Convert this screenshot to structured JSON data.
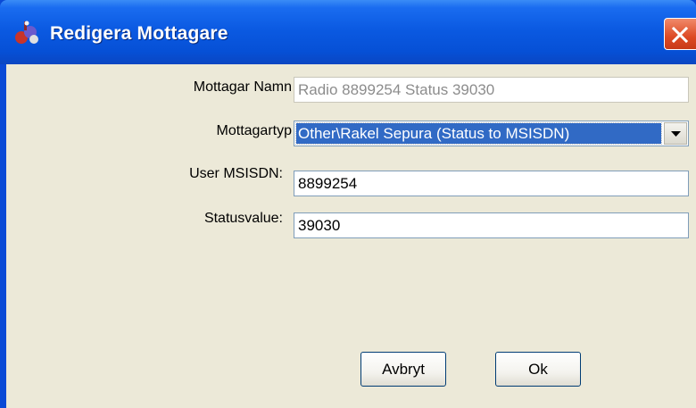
{
  "window": {
    "title": "Redigera Mottagare"
  },
  "form": {
    "name": {
      "label": "Mottagar Namn",
      "value": "Radio 8899254 Status 39030"
    },
    "type": {
      "label": "Mottagartyp",
      "value": "Other\\Rakel Sepura (Status to MSISDN)"
    },
    "msisdn": {
      "label": "User MSISDN:",
      "value": "8899254"
    },
    "status": {
      "label": "Statusvalue:",
      "value": "39030"
    }
  },
  "buttons": {
    "cancel": "Avbryt",
    "ok": "Ok"
  }
}
